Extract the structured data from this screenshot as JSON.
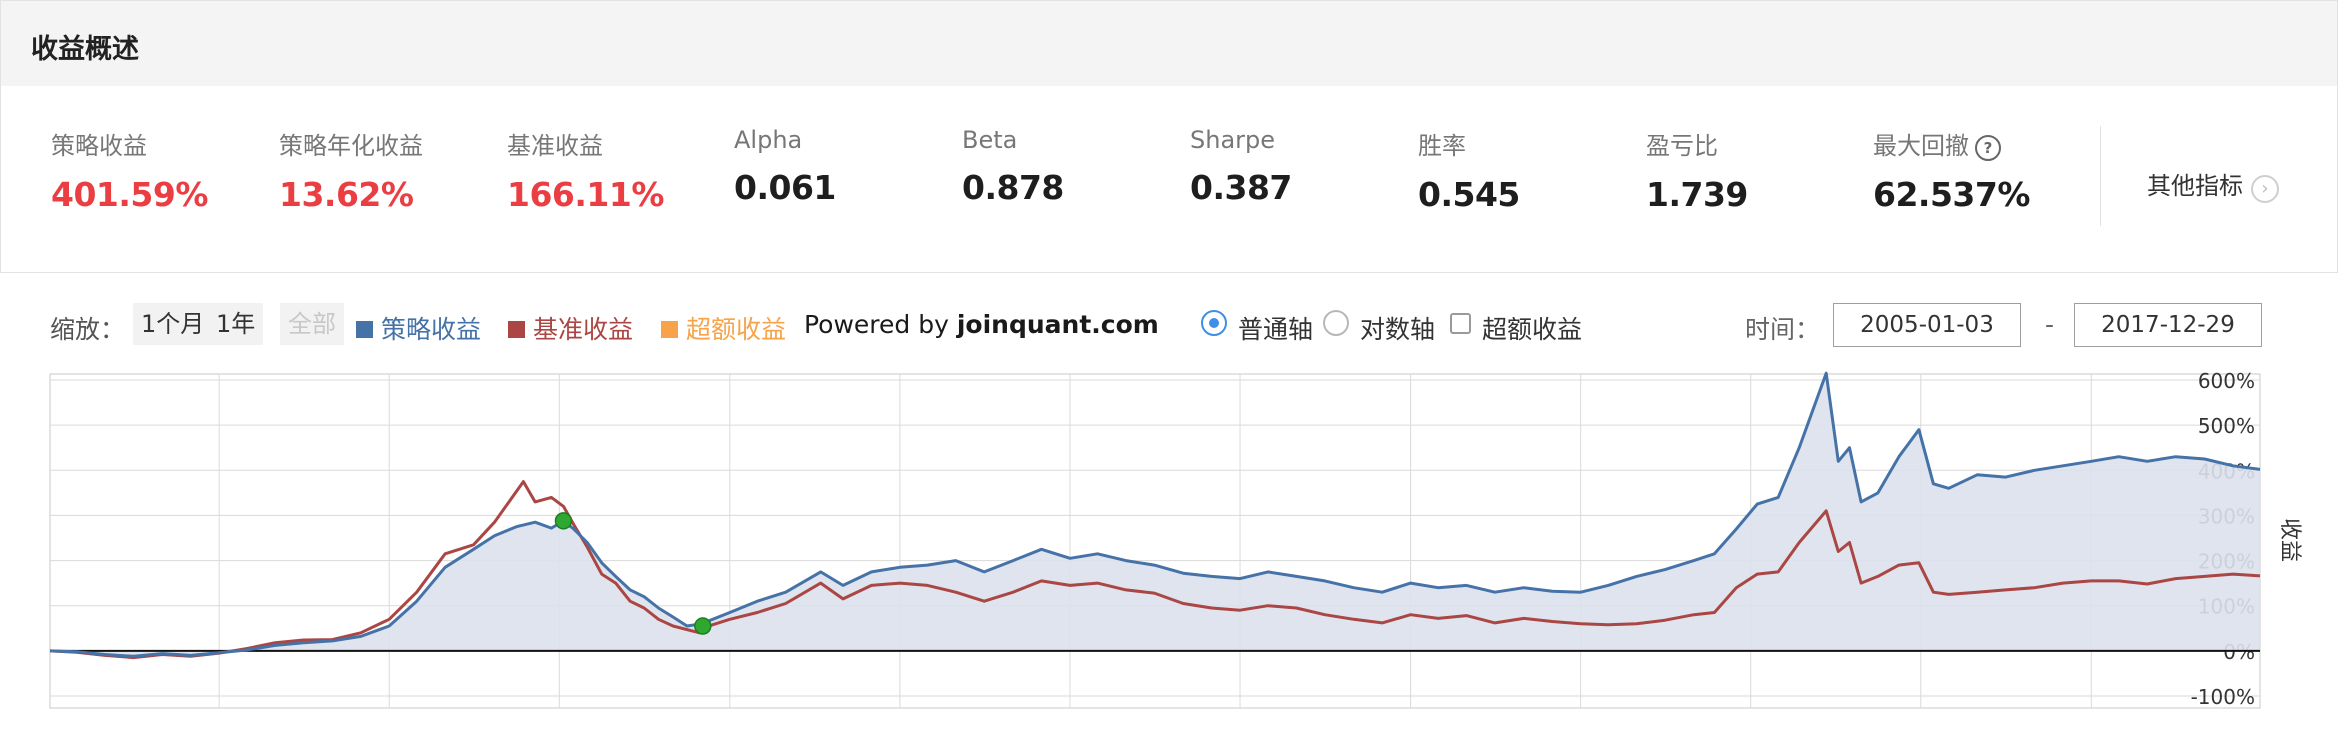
{
  "header": {
    "title": "收益概述"
  },
  "metrics": [
    {
      "label": "策略收益",
      "value": "401.59%",
      "tone": "red"
    },
    {
      "label": "策略年化收益",
      "value": "13.62%",
      "tone": "red"
    },
    {
      "label": "基准收益",
      "value": "166.11%",
      "tone": "red"
    },
    {
      "label": "Alpha",
      "value": "0.061",
      "tone": "dark"
    },
    {
      "label": "Beta",
      "value": "0.878",
      "tone": "dark"
    },
    {
      "label": "Sharpe",
      "value": "0.387",
      "tone": "dark"
    },
    {
      "label": "胜率",
      "value": "0.545",
      "tone": "dark"
    },
    {
      "label": "盈亏比",
      "value": "1.739",
      "tone": "dark"
    },
    {
      "label": "最大回撤",
      "value": "62.537%",
      "tone": "dark",
      "help_icon": "question-circle-icon"
    }
  ],
  "other_metrics": {
    "label": "其他指标",
    "icon": "chevron-right-circle-icon"
  },
  "toolbar": {
    "zoom_label": "缩放：",
    "zoom_options": [
      {
        "label": "1个月",
        "enabled": true
      },
      {
        "label": "1年",
        "enabled": true
      },
      {
        "label": "全部",
        "enabled": false
      }
    ],
    "legend": [
      {
        "label": "策略收益",
        "color": "#4572a7"
      },
      {
        "label": "基准收益",
        "color": "#aa4643"
      },
      {
        "label": "超额收益",
        "color": "#f7a34a"
      }
    ],
    "powered_prefix": "Powered by ",
    "powered_site": "joinquant.com",
    "axis_options": [
      {
        "label": "普通轴",
        "checked": true
      },
      {
        "label": "对数轴",
        "checked": false
      }
    ],
    "excess_toggle": {
      "label": "超额收益",
      "checked": false
    },
    "time_label": "时间：",
    "date_start": "2005-01-03",
    "date_sep": "-",
    "date_end": "2017-12-29"
  },
  "colors": {
    "strategy": "#4572a7",
    "benchmark": "#aa4643",
    "excess": "#f7a34a",
    "area_fill": "#dbe1ec",
    "drawdown_marker": "#2fa832",
    "positive": "#ea3e42"
  },
  "chart_data": {
    "type": "area",
    "x_range": [
      "2005-01-03",
      "2017-12-29"
    ],
    "ylabel": "收益",
    "y_ticks": [
      "600%",
      "500%",
      "400%",
      "300%",
      "200%",
      "100%",
      "0%",
      "-100%"
    ],
    "ylim": [
      -100,
      650
    ],
    "grid": true,
    "series": [
      {
        "name": "策略收益",
        "area": true,
        "points": [
          [
            "2005-01-03",
            0
          ],
          [
            "2005-03-01",
            -2
          ],
          [
            "2005-05-01",
            -8
          ],
          [
            "2005-07-01",
            -12
          ],
          [
            "2005-09-01",
            -6
          ],
          [
            "2005-11-01",
            -10
          ],
          [
            "2006-01-01",
            -4
          ],
          [
            "2006-03-01",
            2
          ],
          [
            "2006-05-01",
            12
          ],
          [
            "2006-07-01",
            18
          ],
          [
            "2006-09-01",
            22
          ],
          [
            "2006-11-01",
            32
          ],
          [
            "2007-01-01",
            55
          ],
          [
            "2007-03-01",
            110
          ],
          [
            "2007-05-01",
            185
          ],
          [
            "2007-07-01",
            225
          ],
          [
            "2007-08-15",
            255
          ],
          [
            "2007-10-01",
            275
          ],
          [
            "2007-11-10",
            285
          ],
          [
            "2007-12-15",
            272
          ],
          [
            "2008-01-10",
            288
          ],
          [
            "2008-02-01",
            270
          ],
          [
            "2008-03-01",
            240
          ],
          [
            "2008-04-01",
            195
          ],
          [
            "2008-05-01",
            165
          ],
          [
            "2008-06-01",
            135
          ],
          [
            "2008-07-01",
            120
          ],
          [
            "2008-08-01",
            95
          ],
          [
            "2008-09-01",
            75
          ],
          [
            "2008-10-01",
            55
          ],
          [
            "2008-11-01",
            60
          ],
          [
            "2009-01-01",
            85
          ],
          [
            "2009-03-01",
            110
          ],
          [
            "2009-05-01",
            130
          ],
          [
            "2009-07-15",
            175
          ],
          [
            "2009-09-01",
            145
          ],
          [
            "2009-11-01",
            175
          ],
          [
            "2010-01-01",
            185
          ],
          [
            "2010-03-01",
            190
          ],
          [
            "2010-05-01",
            200
          ],
          [
            "2010-07-01",
            175
          ],
          [
            "2010-09-01",
            200
          ],
          [
            "2010-11-01",
            225
          ],
          [
            "2011-01-01",
            205
          ],
          [
            "2011-03-01",
            215
          ],
          [
            "2011-05-01",
            200
          ],
          [
            "2011-07-01",
            190
          ],
          [
            "2011-09-01",
            172
          ],
          [
            "2011-11-01",
            165
          ],
          [
            "2012-01-01",
            160
          ],
          [
            "2012-03-01",
            175
          ],
          [
            "2012-05-01",
            165
          ],
          [
            "2012-07-01",
            155
          ],
          [
            "2012-09-01",
            140
          ],
          [
            "2012-11-01",
            130
          ],
          [
            "2013-01-01",
            150
          ],
          [
            "2013-03-01",
            140
          ],
          [
            "2013-05-01",
            145
          ],
          [
            "2013-07-01",
            130
          ],
          [
            "2013-09-01",
            140
          ],
          [
            "2013-11-01",
            132
          ],
          [
            "2014-01-01",
            130
          ],
          [
            "2014-03-01",
            145
          ],
          [
            "2014-05-01",
            165
          ],
          [
            "2014-07-01",
            180
          ],
          [
            "2014-09-01",
            200
          ],
          [
            "2014-10-15",
            215
          ],
          [
            "2014-12-01",
            270
          ],
          [
            "2015-01-15",
            325
          ],
          [
            "2015-03-01",
            340
          ],
          [
            "2015-04-15",
            450
          ],
          [
            "2015-06-12",
            615
          ],
          [
            "2015-07-08",
            420
          ],
          [
            "2015-08-01",
            450
          ],
          [
            "2015-08-26",
            330
          ],
          [
            "2015-10-01",
            350
          ],
          [
            "2015-11-15",
            430
          ],
          [
            "2015-12-28",
            490
          ],
          [
            "2016-01-28",
            370
          ],
          [
            "2016-03-01",
            360
          ],
          [
            "2016-05-01",
            390
          ],
          [
            "2016-07-01",
            385
          ],
          [
            "2016-09-01",
            400
          ],
          [
            "2016-11-01",
            410
          ],
          [
            "2017-01-01",
            420
          ],
          [
            "2017-03-01",
            430
          ],
          [
            "2017-05-01",
            420
          ],
          [
            "2017-07-01",
            430
          ],
          [
            "2017-09-01",
            425
          ],
          [
            "2017-11-01",
            410
          ],
          [
            "2017-12-29",
            402
          ]
        ]
      },
      {
        "name": "基准收益",
        "points": [
          [
            "2005-01-03",
            0
          ],
          [
            "2005-03-01",
            -3
          ],
          [
            "2005-05-01",
            -10
          ],
          [
            "2005-07-01",
            -15
          ],
          [
            "2005-09-01",
            -8
          ],
          [
            "2005-11-01",
            -12
          ],
          [
            "2006-01-01",
            -5
          ],
          [
            "2006-03-01",
            5
          ],
          [
            "2006-05-01",
            18
          ],
          [
            "2006-07-01",
            24
          ],
          [
            "2006-09-01",
            25
          ],
          [
            "2006-11-01",
            40
          ],
          [
            "2007-01-01",
            70
          ],
          [
            "2007-03-01",
            130
          ],
          [
            "2007-05-01",
            215
          ],
          [
            "2007-07-01",
            235
          ],
          [
            "2007-08-15",
            285
          ],
          [
            "2007-10-16",
            375
          ],
          [
            "2007-11-10",
            330
          ],
          [
            "2007-12-15",
            340
          ],
          [
            "2008-01-10",
            320
          ],
          [
            "2008-02-01",
            280
          ],
          [
            "2008-03-01",
            230
          ],
          [
            "2008-04-01",
            170
          ],
          [
            "2008-05-01",
            150
          ],
          [
            "2008-06-01",
            110
          ],
          [
            "2008-07-01",
            95
          ],
          [
            "2008-08-01",
            70
          ],
          [
            "2008-09-01",
            55
          ],
          [
            "2008-10-28",
            40
          ],
          [
            "2008-11-01",
            50
          ],
          [
            "2009-01-01",
            70
          ],
          [
            "2009-03-01",
            85
          ],
          [
            "2009-05-01",
            105
          ],
          [
            "2009-07-15",
            150
          ],
          [
            "2009-09-01",
            115
          ],
          [
            "2009-11-01",
            145
          ],
          [
            "2010-01-01",
            150
          ],
          [
            "2010-03-01",
            145
          ],
          [
            "2010-05-01",
            130
          ],
          [
            "2010-07-01",
            110
          ],
          [
            "2010-09-01",
            130
          ],
          [
            "2010-11-01",
            155
          ],
          [
            "2011-01-01",
            145
          ],
          [
            "2011-03-01",
            150
          ],
          [
            "2011-05-01",
            135
          ],
          [
            "2011-07-01",
            128
          ],
          [
            "2011-09-01",
            105
          ],
          [
            "2011-11-01",
            95
          ],
          [
            "2012-01-01",
            90
          ],
          [
            "2012-03-01",
            100
          ],
          [
            "2012-05-01",
            95
          ],
          [
            "2012-07-01",
            80
          ],
          [
            "2012-09-01",
            70
          ],
          [
            "2012-11-01",
            62
          ],
          [
            "2013-01-01",
            80
          ],
          [
            "2013-03-01",
            72
          ],
          [
            "2013-05-01",
            78
          ],
          [
            "2013-07-01",
            62
          ],
          [
            "2013-09-01",
            72
          ],
          [
            "2013-11-01",
            65
          ],
          [
            "2014-01-01",
            60
          ],
          [
            "2014-03-01",
            58
          ],
          [
            "2014-05-01",
            60
          ],
          [
            "2014-07-01",
            68
          ],
          [
            "2014-09-01",
            80
          ],
          [
            "2014-10-15",
            85
          ],
          [
            "2014-12-01",
            140
          ],
          [
            "2015-01-15",
            170
          ],
          [
            "2015-03-01",
            175
          ],
          [
            "2015-04-15",
            240
          ],
          [
            "2015-06-12",
            310
          ],
          [
            "2015-07-08",
            220
          ],
          [
            "2015-08-01",
            240
          ],
          [
            "2015-08-26",
            150
          ],
          [
            "2015-10-01",
            165
          ],
          [
            "2015-11-15",
            190
          ],
          [
            "2015-12-28",
            195
          ],
          [
            "2016-01-28",
            130
          ],
          [
            "2016-03-01",
            125
          ],
          [
            "2016-05-01",
            130
          ],
          [
            "2016-07-01",
            135
          ],
          [
            "2016-09-01",
            140
          ],
          [
            "2016-11-01",
            150
          ],
          [
            "2017-01-01",
            155
          ],
          [
            "2017-03-01",
            155
          ],
          [
            "2017-05-01",
            148
          ],
          [
            "2017-07-01",
            160
          ],
          [
            "2017-09-01",
            165
          ],
          [
            "2017-11-01",
            170
          ],
          [
            "2017-12-29",
            166
          ]
        ]
      }
    ],
    "markers": [
      {
        "type": "drawdown-start",
        "x": "2008-01-10",
        "y": 288
      },
      {
        "type": "drawdown-end",
        "x": "2008-11-04",
        "y": 55
      }
    ]
  }
}
